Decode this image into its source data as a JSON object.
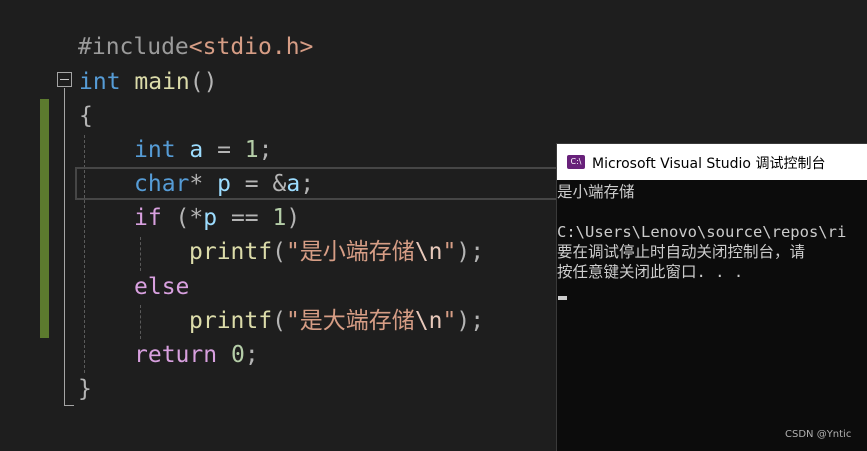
{
  "editor": {
    "lines": [
      {
        "tokens": [
          {
            "t": "#include",
            "c": "pre"
          },
          {
            "t": "<stdio.h>",
            "c": "inc"
          }
        ]
      },
      {
        "tokens": [
          {
            "t": "int",
            "c": "kw"
          },
          {
            "t": " main",
            "c": "fn"
          },
          {
            "t": "()",
            "c": "pun"
          }
        ]
      },
      {
        "tokens": [
          {
            "t": "{",
            "c": "pun"
          }
        ]
      },
      {
        "tokens": [
          {
            "t": "int",
            "c": "kw"
          },
          {
            "t": " a",
            "c": "var"
          },
          {
            "t": " = ",
            "c": "pun"
          },
          {
            "t": "1",
            "c": "num"
          },
          {
            "t": ";",
            "c": "pun"
          }
        ]
      },
      {
        "tokens": [
          {
            "t": "char",
            "c": "kw"
          },
          {
            "t": "* ",
            "c": "pun"
          },
          {
            "t": "p",
            "c": "var"
          },
          {
            "t": " = &",
            "c": "pun"
          },
          {
            "t": "a",
            "c": "var"
          },
          {
            "t": ";",
            "c": "pun"
          }
        ]
      },
      {
        "tokens": [
          {
            "t": "if",
            "c": "ctl"
          },
          {
            "t": " (*",
            "c": "pun"
          },
          {
            "t": "p",
            "c": "var"
          },
          {
            "t": " == ",
            "c": "pun"
          },
          {
            "t": "1",
            "c": "num"
          },
          {
            "t": ")",
            "c": "pun"
          }
        ]
      },
      {
        "tokens": [
          {
            "t": "printf",
            "c": "fn"
          },
          {
            "t": "(",
            "c": "pun"
          },
          {
            "t": "\"是小端存储",
            "c": "str"
          },
          {
            "t": "\\n",
            "c": "esc"
          },
          {
            "t": "\"",
            "c": "str"
          },
          {
            "t": ");",
            "c": "pun"
          }
        ]
      },
      {
        "tokens": [
          {
            "t": "else",
            "c": "ctl"
          }
        ]
      },
      {
        "tokens": [
          {
            "t": "printf",
            "c": "fn"
          },
          {
            "t": "(",
            "c": "pun"
          },
          {
            "t": "\"是大端存储",
            "c": "str"
          },
          {
            "t": "\\n",
            "c": "esc"
          },
          {
            "t": "\"",
            "c": "str"
          },
          {
            "t": ");",
            "c": "pun"
          }
        ]
      },
      {
        "tokens": [
          {
            "t": "return",
            "c": "ctl"
          },
          {
            "t": " ",
            "c": "pun"
          },
          {
            "t": "0",
            "c": "num"
          },
          {
            "t": ";",
            "c": "pun"
          }
        ]
      },
      {
        "tokens": [
          {
            "t": "}",
            "c": "pun"
          }
        ]
      }
    ]
  },
  "console": {
    "icon_text": "C:\\",
    "title": "Microsoft Visual Studio 调试控制台",
    "output": [
      "是小端存储",
      "",
      "C:\\Users\\Lenovo\\source\\repos\\ri",
      "要在调试停止时自动关闭控制台，请",
      "按任意键关闭此窗口. . ."
    ]
  },
  "watermark": "CSDN @Yntic",
  "colors": {
    "editor_bg": "#1e1e1e",
    "keyword": "#569cd6",
    "control": "#d8a0df",
    "variable": "#9cdcfe",
    "number": "#b5cea8",
    "function": "#dcdcaa",
    "string": "#d69d85",
    "change_bar": "#5c7a2e",
    "console_bg": "#0c0c0c"
  }
}
